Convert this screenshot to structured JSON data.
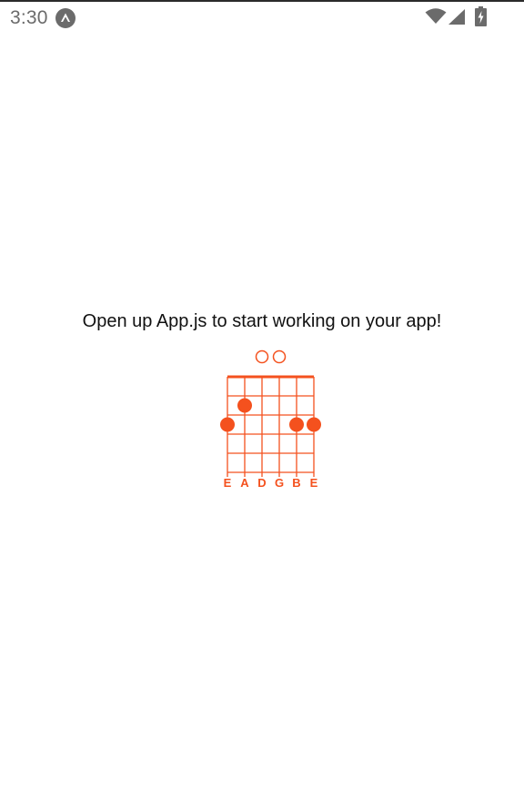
{
  "status_bar": {
    "time": "3:30",
    "app_icon": "expo-icon",
    "icons": [
      "wifi-icon",
      "cellular-signal-icon",
      "battery-charging-icon"
    ]
  },
  "main": {
    "message": "Open up App.js to start working on your app!"
  },
  "chord_diagram": {
    "color": "#f4511e",
    "strings": [
      "E",
      "A",
      "D",
      "G",
      "B",
      "E"
    ],
    "open_strings": [
      2,
      3
    ],
    "fingers": [
      {
        "string": 0,
        "fret": 3
      },
      {
        "string": 1,
        "fret": 2
      },
      {
        "string": 4,
        "fret": 3
      },
      {
        "string": 5,
        "fret": 3
      }
    ],
    "fret_count": 5
  }
}
